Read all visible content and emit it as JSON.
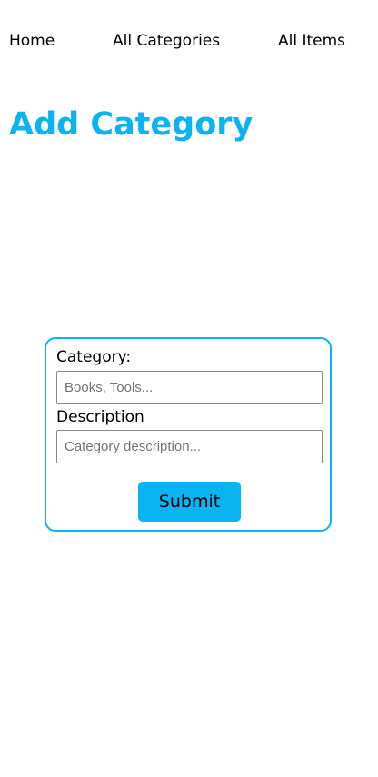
{
  "nav": {
    "home_label": "Home",
    "categories_label": "All Categories",
    "items_label": "All Items"
  },
  "page": {
    "title": "Add Category"
  },
  "form": {
    "category_label": "Category:",
    "category_placeholder": "Books, Tools...",
    "category_value": "",
    "description_label": "Description",
    "description_placeholder": "Category description...",
    "description_value": "",
    "submit_label": "Submit"
  },
  "colors": {
    "accent": "#0ab4f0",
    "text": "#000000",
    "background": "#ffffff"
  }
}
